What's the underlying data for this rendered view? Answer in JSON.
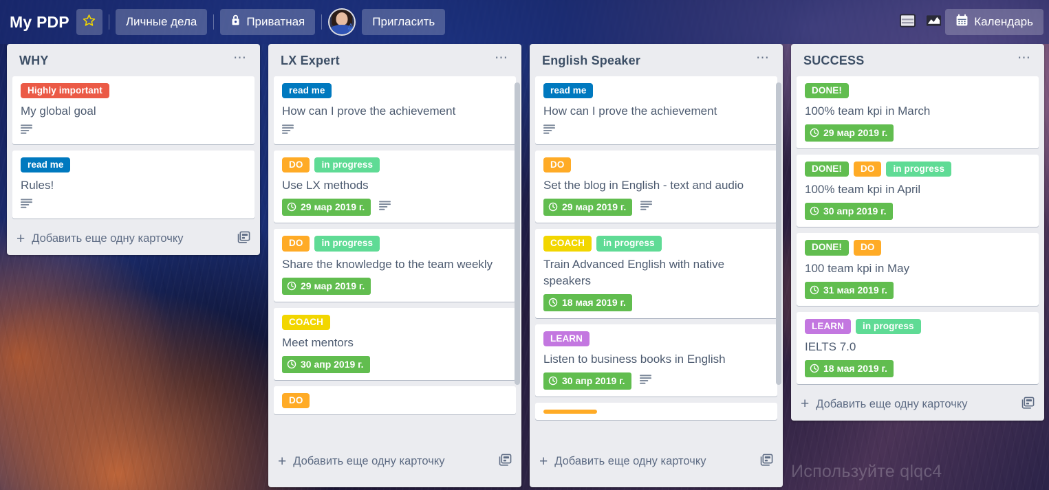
{
  "header": {
    "board_title": "My PDP",
    "star_icon": "star-icon",
    "workspace_button": "Личные дела",
    "visibility_icon": "lock-icon",
    "visibility_button": "Приватная",
    "avatar": "user-avatar",
    "invite_button": "Пригласить",
    "view_board_icon": "board-view-icon",
    "view_chart_icon": "chart-view-icon",
    "calendar_icon": "calendar-icon",
    "calendar_button": "Календарь"
  },
  "colors": {
    "label_red": "#eb5a46",
    "label_blue": "#0079bf",
    "label_orange": "#ffab26",
    "label_green_soft": "#5fdb95",
    "label_yellow": "#f2d600",
    "label_purple": "#c377e0",
    "label_green": "#61bd4f",
    "due_green": "#61bd4f",
    "list_bg": "#ebecf0",
    "header_bg": "#1c2d78"
  },
  "add_card_label": "Добавить еще одну карточку",
  "watermark": "Используйте qlqc4",
  "lists": [
    {
      "title": "WHY",
      "menu_icon": "list-menu-icon",
      "scrollable": false,
      "cards": [
        {
          "labels": [
            {
              "text": "Highly important",
              "color": "#eb5a46"
            }
          ],
          "title": "My global goal",
          "due": null,
          "has_description": true
        },
        {
          "labels": [
            {
              "text": "read me",
              "color": "#0079bf"
            }
          ],
          "title": "Rules!",
          "due": null,
          "has_description": true
        }
      ]
    },
    {
      "title": "LX Expert",
      "menu_icon": "list-menu-icon",
      "scrollable": true,
      "cards": [
        {
          "labels": [
            {
              "text": "read me",
              "color": "#0079bf"
            }
          ],
          "title": "How can I prove the achievement",
          "due": null,
          "has_description": true
        },
        {
          "labels": [
            {
              "text": "DO",
              "color": "#ffab26"
            },
            {
              "text": "in progress",
              "color": "#5fdb95"
            }
          ],
          "title": "Use LX methods",
          "due": "29 мар 2019 г.",
          "has_description": true
        },
        {
          "labels": [
            {
              "text": "DO",
              "color": "#ffab26"
            },
            {
              "text": "in progress",
              "color": "#5fdb95"
            }
          ],
          "title": "Share the knowledge to the team weekly",
          "due": "29 мар 2019 г.",
          "has_description": false
        },
        {
          "labels": [
            {
              "text": "COACH",
              "color": "#f2d600"
            }
          ],
          "title": "Meet mentors",
          "due": "30 апр 2019 г.",
          "has_description": false
        },
        {
          "labels": [
            {
              "text": "DO",
              "color": "#ffab26"
            }
          ],
          "title": "",
          "due": null,
          "has_description": false,
          "clipped": true
        }
      ]
    },
    {
      "title": "English Speaker",
      "menu_icon": "list-menu-icon",
      "scrollable": true,
      "cards": [
        {
          "labels": [
            {
              "text": "read me",
              "color": "#0079bf"
            }
          ],
          "title": "How can I prove the achievement",
          "due": null,
          "has_description": true
        },
        {
          "labels": [
            {
              "text": "DO",
              "color": "#ffab26"
            }
          ],
          "title": "Set the blog in English - text and audio",
          "due": "29 мар 2019 г.",
          "has_description": true
        },
        {
          "labels": [
            {
              "text": "COACH",
              "color": "#f2d600"
            },
            {
              "text": "in progress",
              "color": "#5fdb95"
            }
          ],
          "title": "Train Advanced English with native speakers",
          "due": "18 мая 2019 г.",
          "has_description": false
        },
        {
          "labels": [
            {
              "text": "LEARN",
              "color": "#c377e0"
            }
          ],
          "title": "Listen to business books in English",
          "due": "30 апр 2019 г.",
          "has_description": true
        },
        {
          "labels": [
            {
              "text": "",
              "color": "#ffab26"
            }
          ],
          "title": "",
          "due": null,
          "has_description": false,
          "clipped": true
        }
      ]
    },
    {
      "title": "SUCCESS",
      "menu_icon": "list-menu-icon",
      "scrollable": false,
      "cards": [
        {
          "labels": [
            {
              "text": "DONE!",
              "color": "#61bd4f"
            }
          ],
          "title": "100% team kpi in March",
          "due": "29 мар 2019 г.",
          "has_description": false
        },
        {
          "labels": [
            {
              "text": "DONE!",
              "color": "#61bd4f"
            },
            {
              "text": "DO",
              "color": "#ffab26"
            },
            {
              "text": "in progress",
              "color": "#5fdb95"
            }
          ],
          "title": "100% team kpi in April",
          "due": "30 апр 2019 г.",
          "has_description": false
        },
        {
          "labels": [
            {
              "text": "DONE!",
              "color": "#61bd4f"
            },
            {
              "text": "DO",
              "color": "#ffab26"
            }
          ],
          "title": "100 team kpi in May",
          "due": "31 мая 2019 г.",
          "has_description": false
        },
        {
          "labels": [
            {
              "text": "LEARN",
              "color": "#c377e0"
            },
            {
              "text": "in progress",
              "color": "#5fdb95"
            }
          ],
          "title": "IELTS 7.0",
          "due": "18 мая 2019 г.",
          "has_description": false
        }
      ]
    }
  ]
}
